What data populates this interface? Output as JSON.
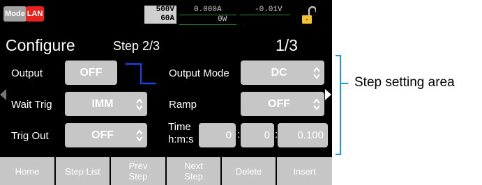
{
  "status": {
    "mode_label": "Mode",
    "lan_label": "LAN",
    "range_voltage": "500V",
    "range_current": "60A",
    "current_reading": "0.000A",
    "voltage_reading": "-0.01V",
    "power_reading": "0W",
    "lock_icon": "padlock-open-icon"
  },
  "header": {
    "title": "Configure",
    "step": "Step 2/3",
    "page": "1/3"
  },
  "fields": {
    "output_label": "Output",
    "output_value": "OFF",
    "output_mode_label": "Output Mode",
    "output_mode_value": "DC",
    "wait_trig_label": "Wait Trig",
    "wait_trig_value": "IMM",
    "ramp_label": "Ramp",
    "ramp_value": "OFF",
    "trig_out_label": "Trig Out",
    "trig_out_value": "OFF",
    "time_label_line1": "Time",
    "time_label_line2": "h:m:s",
    "time_hours": "0",
    "time_minutes": "0",
    "time_seconds": "0.100",
    "time_separator": ":"
  },
  "buttons": {
    "home": "Home",
    "step_list": "Step List",
    "prev_step_line1": "Prev",
    "prev_step_line2": "Step",
    "next_step_line1": "Next",
    "next_step_line2": "Step",
    "delete": "Delete",
    "insert": "Insert"
  },
  "annotation": {
    "callout": "Step setting area"
  },
  "colors": {
    "screen_bg": "#000000",
    "control_bg": "#c6c6c6",
    "lan_red": "#e8231e",
    "accent_blue": "#1f9ad6",
    "output_waveform": "#1f3fe0",
    "lock_yellow": "#f2c230"
  }
}
